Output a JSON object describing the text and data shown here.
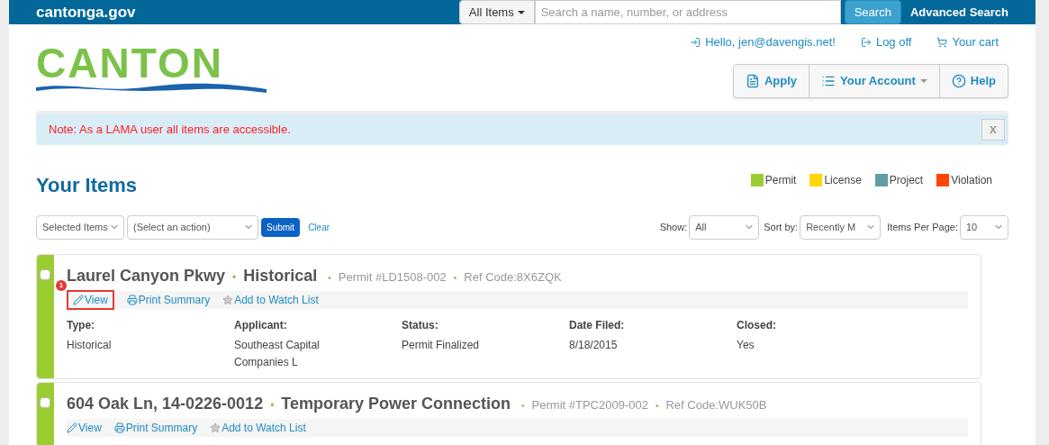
{
  "topbar": {
    "site": "cantonga.gov",
    "scope": "All Items",
    "search_placeholder": "Search a name, number, or address",
    "search_button": "Search",
    "advanced": "Advanced Search"
  },
  "logo": {
    "text": "CANTON"
  },
  "user_links": [
    {
      "label": "Hello, jen@davengis.net!"
    },
    {
      "label": "Log off"
    },
    {
      "label": "Your cart"
    }
  ],
  "nav": [
    {
      "label": "Apply",
      "caret": false
    },
    {
      "label": "Your Account",
      "caret": true
    },
    {
      "label": "Help",
      "caret": false
    }
  ],
  "alert": {
    "text": "Note: As a LAMA user all items are accessible.",
    "close": "x"
  },
  "heading": "Your Items",
  "legend": [
    {
      "label": "Permit",
      "color": "#9acd32"
    },
    {
      "label": "License",
      "color": "#ffd700"
    },
    {
      "label": "Project",
      "color": "#5f9ea0"
    },
    {
      "label": "Violation",
      "color": "#ff4500"
    }
  ],
  "toolbar": {
    "selection": "Selected Items",
    "action": "(Select an action)",
    "submit": "Submit",
    "clear": "Clear",
    "show_label": "Show:",
    "show": "All",
    "sort_label": "Sort by:",
    "sort": "Recently M",
    "per_page_label": "Items Per Page:",
    "per_page": "10"
  },
  "items": [
    {
      "color": "#9acd32",
      "checked": false,
      "address": "Laurel Canyon Pkwy",
      "type": "Historical",
      "permit": "Permit #LD1508-002",
      "ref": "Ref Code:8X6ZQK",
      "dots": [
        "•",
        "•",
        "•"
      ],
      "actions": [
        {
          "label": "View",
          "highlight": "1"
        },
        {
          "label": "Print Summary"
        },
        {
          "label": "Add to Watch List"
        }
      ],
      "fields": [
        {
          "label": "Type:",
          "value": "Historical"
        },
        {
          "label": "Applicant:",
          "value": "Southeast Capital Companies L"
        },
        {
          "label": "Status:",
          "value": "Permit Finalized"
        },
        {
          "label": "Date Filed:",
          "value": "8/18/2015"
        },
        {
          "label": "Closed:",
          "value": "Yes"
        }
      ]
    },
    {
      "color": "#9acd32",
      "checked": false,
      "address": "604 Oak Ln, 14-0226-0012",
      "type": "Temporary Power Connection",
      "permit": "Permit #TPC2009-002",
      "ref": "Ref Code:WUK50B",
      "dots": [
        "•",
        "•",
        "•"
      ],
      "actions": [
        {
          "label": "View"
        },
        {
          "label": "Print Summary"
        },
        {
          "label": "Add to Watch List"
        }
      ]
    }
  ]
}
